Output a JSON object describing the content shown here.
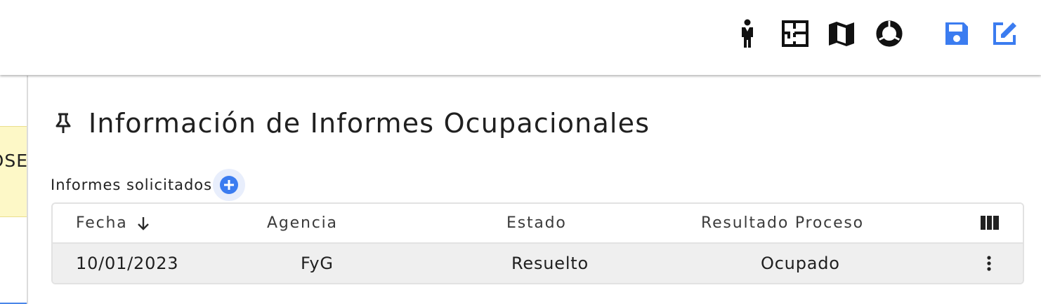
{
  "topbar": {
    "icons": [
      {
        "name": "person-icon"
      },
      {
        "name": "floor-plan-icon"
      },
      {
        "name": "map-icon"
      },
      {
        "name": "donut-chart-icon"
      },
      {
        "name": "save-icon",
        "color": "#3b7cf0"
      },
      {
        "name": "edit-icon",
        "color": "#3b7cf0"
      }
    ]
  },
  "left_panel": {
    "note_text": "OSE"
  },
  "section": {
    "title": "Información de Informes Ocupacionales",
    "subsection_label": "Informes solicitados"
  },
  "table": {
    "columns": [
      "Fecha",
      "Agencia",
      "Estado",
      "Resultado Proceso"
    ],
    "sort_column": "Fecha",
    "sort_direction": "descending",
    "rows": [
      {
        "fecha": "10/01/2023",
        "agencia": "FyG",
        "estado": "Resuelto",
        "resultado": "Ocupado"
      }
    ]
  },
  "colors": {
    "accent": "#3b7cf0",
    "note_background": "#fdf8c7",
    "row_background": "#efefef"
  }
}
